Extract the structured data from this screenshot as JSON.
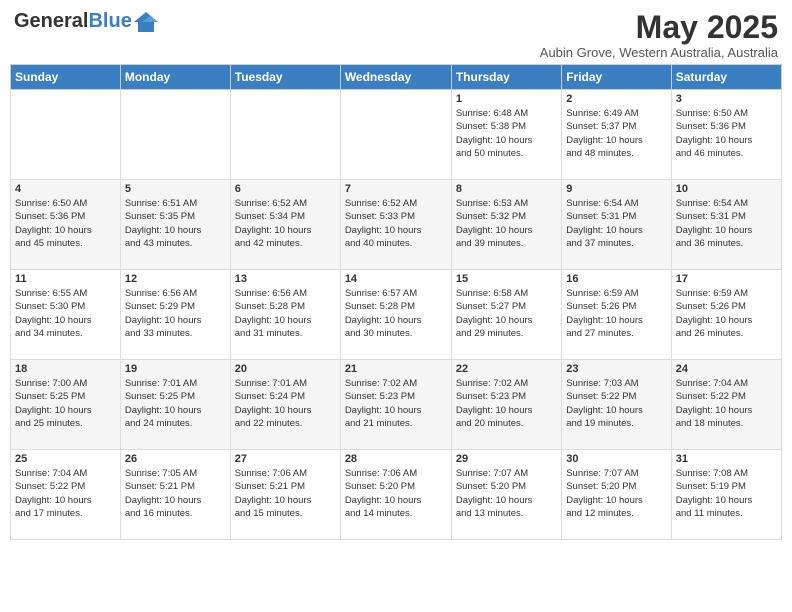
{
  "header": {
    "logo_general": "General",
    "logo_blue": "Blue",
    "month_year": "May 2025",
    "location": "Aubin Grove, Western Australia, Australia"
  },
  "weekdays": [
    "Sunday",
    "Monday",
    "Tuesday",
    "Wednesday",
    "Thursday",
    "Friday",
    "Saturday"
  ],
  "weeks": [
    [
      {
        "day": "",
        "info": ""
      },
      {
        "day": "",
        "info": ""
      },
      {
        "day": "",
        "info": ""
      },
      {
        "day": "",
        "info": ""
      },
      {
        "day": "1",
        "info": "Sunrise: 6:48 AM\nSunset: 5:38 PM\nDaylight: 10 hours\nand 50 minutes."
      },
      {
        "day": "2",
        "info": "Sunrise: 6:49 AM\nSunset: 5:37 PM\nDaylight: 10 hours\nand 48 minutes."
      },
      {
        "day": "3",
        "info": "Sunrise: 6:50 AM\nSunset: 5:36 PM\nDaylight: 10 hours\nand 46 minutes."
      }
    ],
    [
      {
        "day": "4",
        "info": "Sunrise: 6:50 AM\nSunset: 5:36 PM\nDaylight: 10 hours\nand 45 minutes."
      },
      {
        "day": "5",
        "info": "Sunrise: 6:51 AM\nSunset: 5:35 PM\nDaylight: 10 hours\nand 43 minutes."
      },
      {
        "day": "6",
        "info": "Sunrise: 6:52 AM\nSunset: 5:34 PM\nDaylight: 10 hours\nand 42 minutes."
      },
      {
        "day": "7",
        "info": "Sunrise: 6:52 AM\nSunset: 5:33 PM\nDaylight: 10 hours\nand 40 minutes."
      },
      {
        "day": "8",
        "info": "Sunrise: 6:53 AM\nSunset: 5:32 PM\nDaylight: 10 hours\nand 39 minutes."
      },
      {
        "day": "9",
        "info": "Sunrise: 6:54 AM\nSunset: 5:31 PM\nDaylight: 10 hours\nand 37 minutes."
      },
      {
        "day": "10",
        "info": "Sunrise: 6:54 AM\nSunset: 5:31 PM\nDaylight: 10 hours\nand 36 minutes."
      }
    ],
    [
      {
        "day": "11",
        "info": "Sunrise: 6:55 AM\nSunset: 5:30 PM\nDaylight: 10 hours\nand 34 minutes."
      },
      {
        "day": "12",
        "info": "Sunrise: 6:56 AM\nSunset: 5:29 PM\nDaylight: 10 hours\nand 33 minutes."
      },
      {
        "day": "13",
        "info": "Sunrise: 6:56 AM\nSunset: 5:28 PM\nDaylight: 10 hours\nand 31 minutes."
      },
      {
        "day": "14",
        "info": "Sunrise: 6:57 AM\nSunset: 5:28 PM\nDaylight: 10 hours\nand 30 minutes."
      },
      {
        "day": "15",
        "info": "Sunrise: 6:58 AM\nSunset: 5:27 PM\nDaylight: 10 hours\nand 29 minutes."
      },
      {
        "day": "16",
        "info": "Sunrise: 6:59 AM\nSunset: 5:26 PM\nDaylight: 10 hours\nand 27 minutes."
      },
      {
        "day": "17",
        "info": "Sunrise: 6:59 AM\nSunset: 5:26 PM\nDaylight: 10 hours\nand 26 minutes."
      }
    ],
    [
      {
        "day": "18",
        "info": "Sunrise: 7:00 AM\nSunset: 5:25 PM\nDaylight: 10 hours\nand 25 minutes."
      },
      {
        "day": "19",
        "info": "Sunrise: 7:01 AM\nSunset: 5:25 PM\nDaylight: 10 hours\nand 24 minutes."
      },
      {
        "day": "20",
        "info": "Sunrise: 7:01 AM\nSunset: 5:24 PM\nDaylight: 10 hours\nand 22 minutes."
      },
      {
        "day": "21",
        "info": "Sunrise: 7:02 AM\nSunset: 5:23 PM\nDaylight: 10 hours\nand 21 minutes."
      },
      {
        "day": "22",
        "info": "Sunrise: 7:02 AM\nSunset: 5:23 PM\nDaylight: 10 hours\nand 20 minutes."
      },
      {
        "day": "23",
        "info": "Sunrise: 7:03 AM\nSunset: 5:22 PM\nDaylight: 10 hours\nand 19 minutes."
      },
      {
        "day": "24",
        "info": "Sunrise: 7:04 AM\nSunset: 5:22 PM\nDaylight: 10 hours\nand 18 minutes."
      }
    ],
    [
      {
        "day": "25",
        "info": "Sunrise: 7:04 AM\nSunset: 5:22 PM\nDaylight: 10 hours\nand 17 minutes."
      },
      {
        "day": "26",
        "info": "Sunrise: 7:05 AM\nSunset: 5:21 PM\nDaylight: 10 hours\nand 16 minutes."
      },
      {
        "day": "27",
        "info": "Sunrise: 7:06 AM\nSunset: 5:21 PM\nDaylight: 10 hours\nand 15 minutes."
      },
      {
        "day": "28",
        "info": "Sunrise: 7:06 AM\nSunset: 5:20 PM\nDaylight: 10 hours\nand 14 minutes."
      },
      {
        "day": "29",
        "info": "Sunrise: 7:07 AM\nSunset: 5:20 PM\nDaylight: 10 hours\nand 13 minutes."
      },
      {
        "day": "30",
        "info": "Sunrise: 7:07 AM\nSunset: 5:20 PM\nDaylight: 10 hours\nand 12 minutes."
      },
      {
        "day": "31",
        "info": "Sunrise: 7:08 AM\nSunset: 5:19 PM\nDaylight: 10 hours\nand 11 minutes."
      }
    ]
  ]
}
